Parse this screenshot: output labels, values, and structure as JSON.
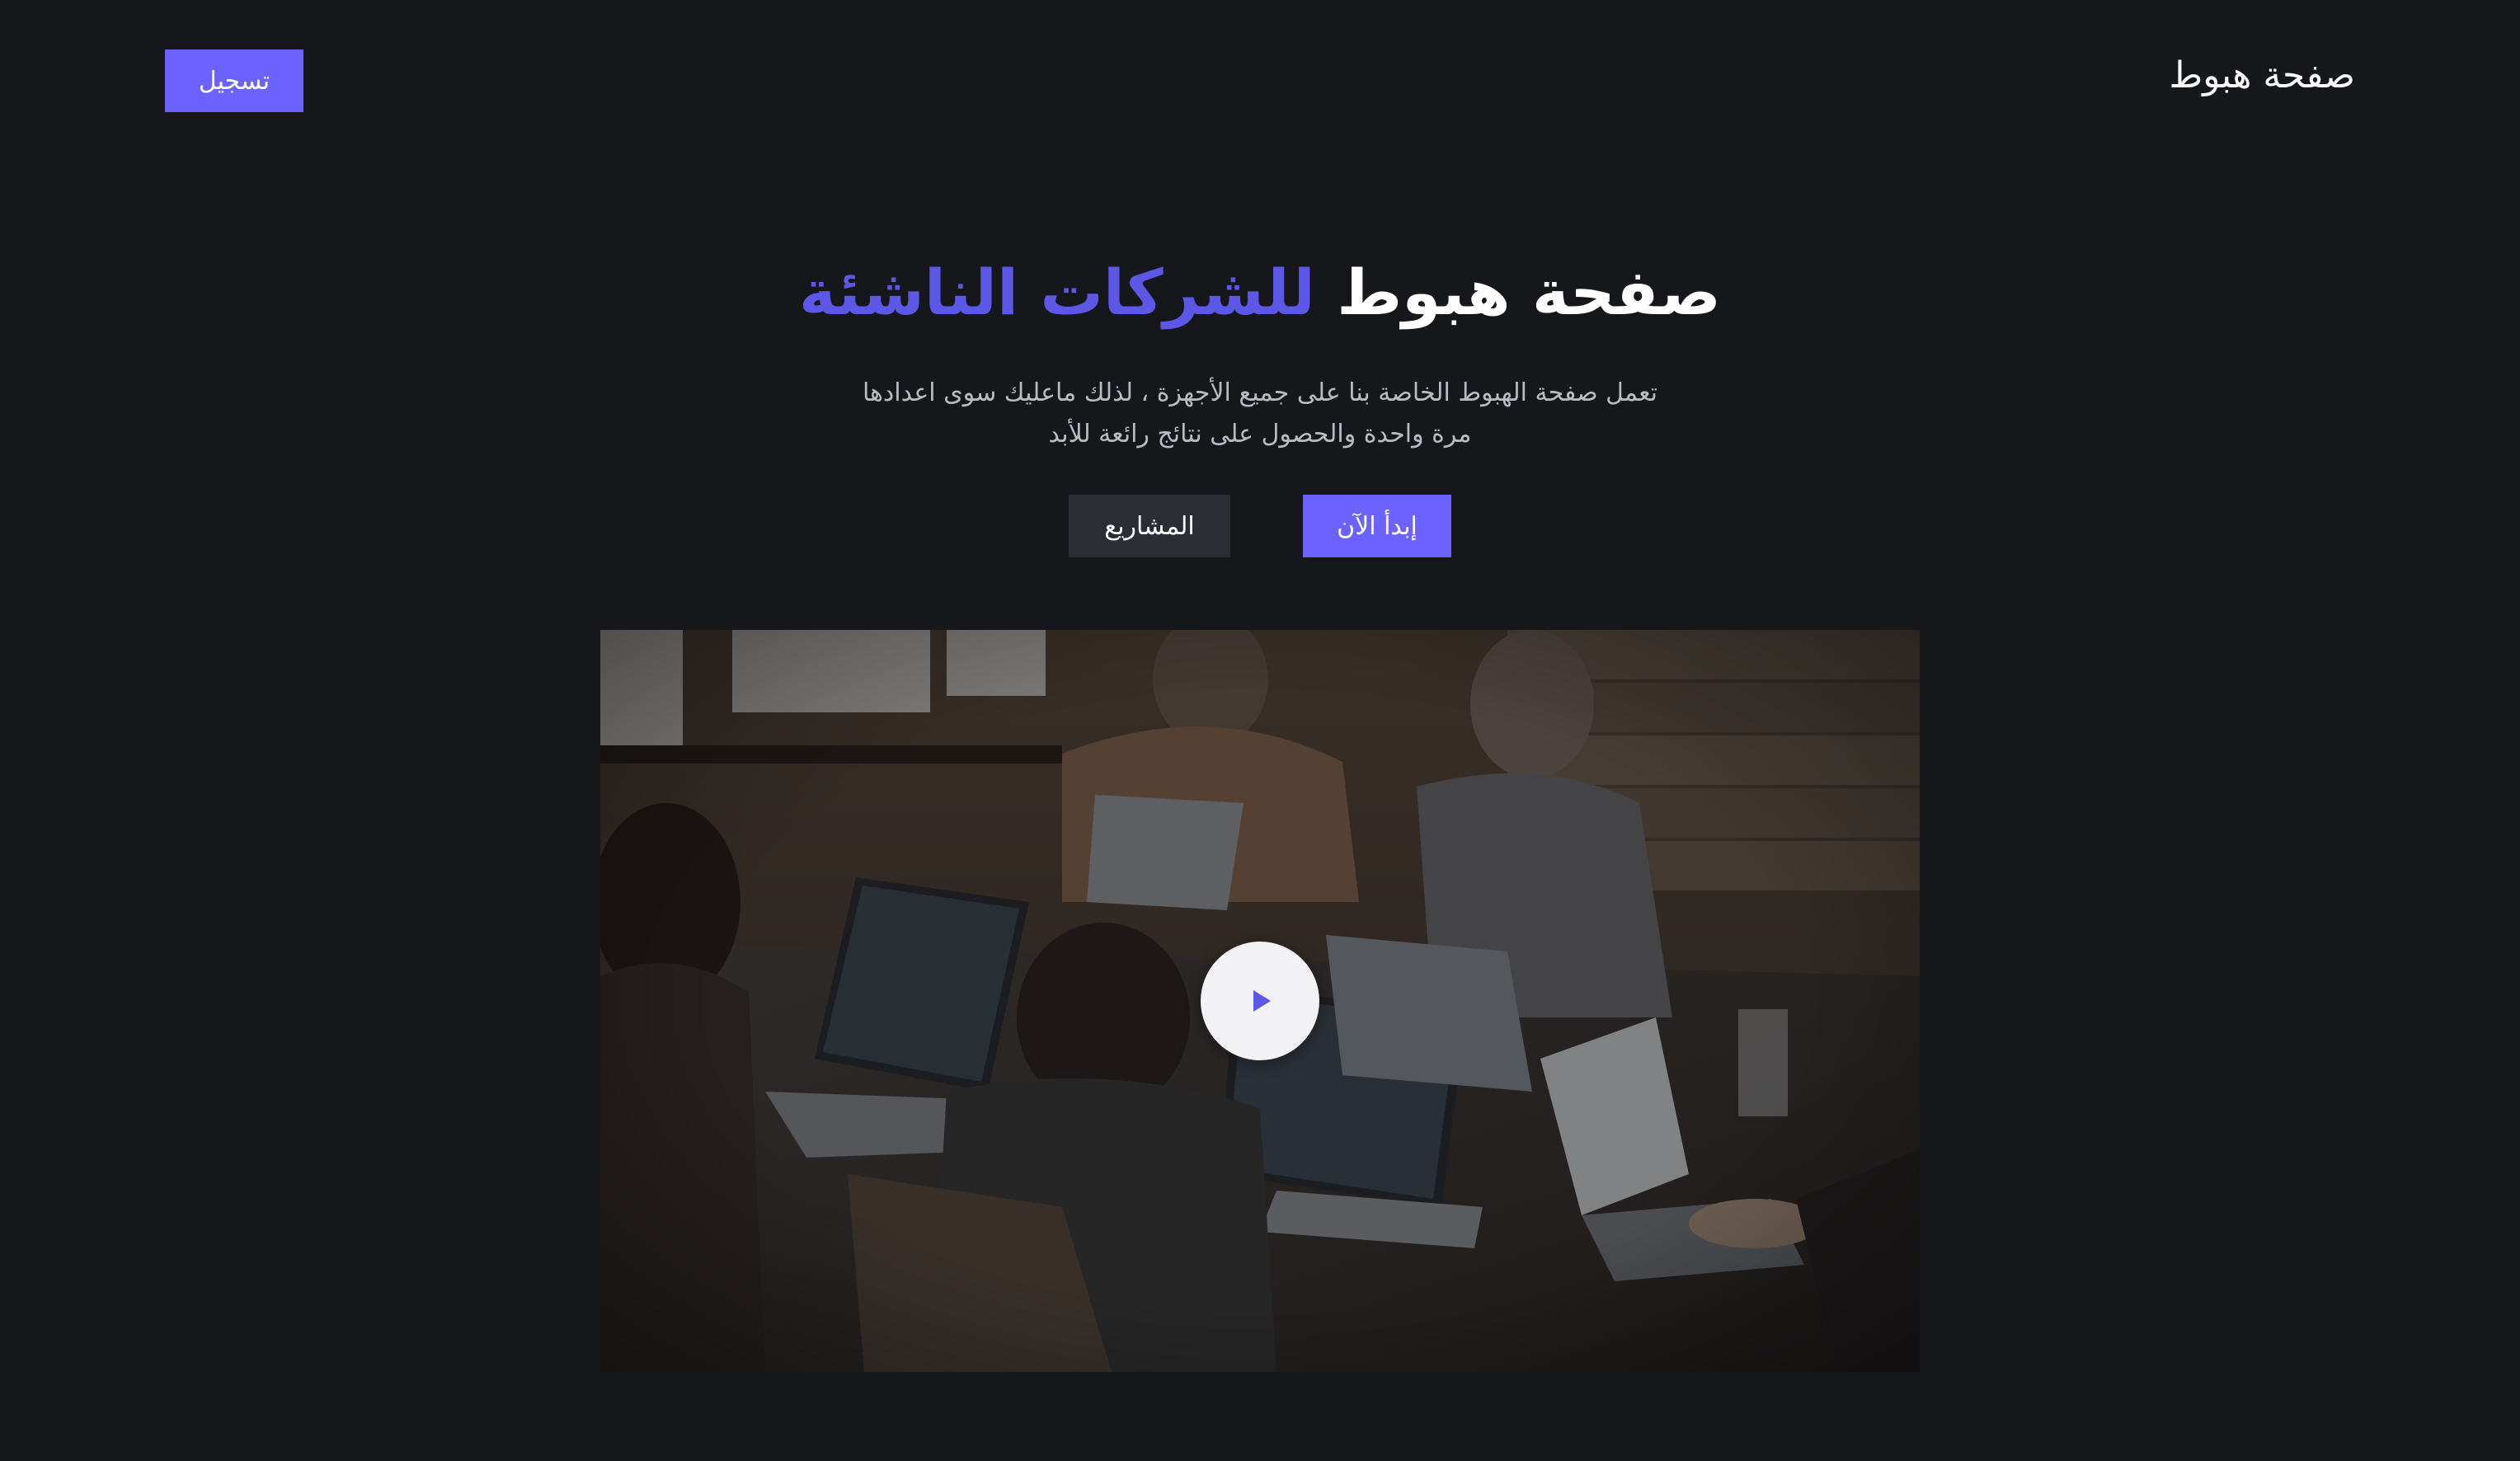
{
  "header": {
    "brand": "صفحة هبوط",
    "signup_label": "تسجيل"
  },
  "hero": {
    "title_main": "صفحة هبوط",
    "title_accent": "للشركات الناشئة",
    "subtitle": "تعمل صفحة الهبوط الخاصة بنا على جميع الأجهزة ، لذلك ماعليك سوى اعدادها مرة واحدة والحصول على نتائج رائعة للأبد",
    "primary_button": "إبدأ الآن",
    "secondary_button": "المشاريع"
  },
  "media": {
    "image_subject": "people-working-on-laptops-photo",
    "play_icon": "play-icon"
  },
  "colors": {
    "background": "#15171a",
    "accent": "#6c63ff",
    "secondary_button": "#2a2d33",
    "subtitle_text": "#b9bcc3"
  }
}
